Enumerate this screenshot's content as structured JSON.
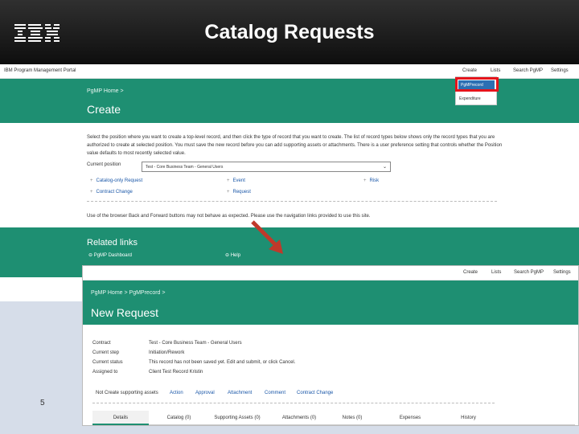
{
  "slide": {
    "title": "Catalog Requests",
    "logo": "IBM",
    "page_number": "5"
  },
  "shot1": {
    "app_name": "IBM Program Management Portal",
    "nav": [
      "Create",
      "Lists",
      "Search PgMP",
      "Settings"
    ],
    "breadcrumb": "PgMP Home  >",
    "page_title": "Create",
    "description": "Select the position where you want to create a top-level record, and then click the type of record that you want to create. The list of record types below shows only the record types that you are authorized to create at selected position. You must save the new record before you can add supporting assets or attachments. There is a user preference setting that controls whether the Position value defaults to most recently selected value.",
    "current_position_label": "Current position",
    "current_position_value": "Test - Core Business Team - General Users",
    "record_types": [
      "Catalog-only Request",
      "Contract Change",
      "Event",
      "Request",
      "Risk"
    ],
    "note": "Use of the browser Back and Forward buttons may not behave as expected. Please use the navigation links provided to use this site.",
    "related_heading": "Related links",
    "related_links": [
      "PgMP Dashboard",
      "Help"
    ],
    "dropdown_items": [
      "PgMPrecord",
      "Expenditure"
    ]
  },
  "shot2": {
    "nav": [
      "Create",
      "Lists",
      "Search PgMP",
      "Settings"
    ],
    "breadcrumb": "PgMP Home  >  PgMPrecord  >",
    "page_title": "New Request",
    "fields": [
      {
        "label": "Contract",
        "value": "Test - Core Business Team - General Users"
      },
      {
        "label": "Current step",
        "value": "Initiation/Rework"
      },
      {
        "label": "Current status",
        "value": "This record has not been saved yet. Edit and submit, or click Cancel."
      },
      {
        "label": "Assigned to",
        "value": "Client Test Record Kristin"
      }
    ],
    "supporting_label": "Not Create supporting assets",
    "actions": [
      "Action",
      "Approval",
      "Attachment",
      "Comment",
      "Contract Change"
    ],
    "tabs": [
      "Details",
      "Catalog (0)",
      "Supporting Assets (0)",
      "Attachments (0)",
      "Notes (0)",
      "Expenses",
      "History"
    ]
  },
  "colors": {
    "header_bg": "#1a1a1a",
    "teal": "#1e8f72",
    "highlight": "#e5141c",
    "arrow": "#c0392b",
    "slide_bg": "#d6dde9"
  }
}
